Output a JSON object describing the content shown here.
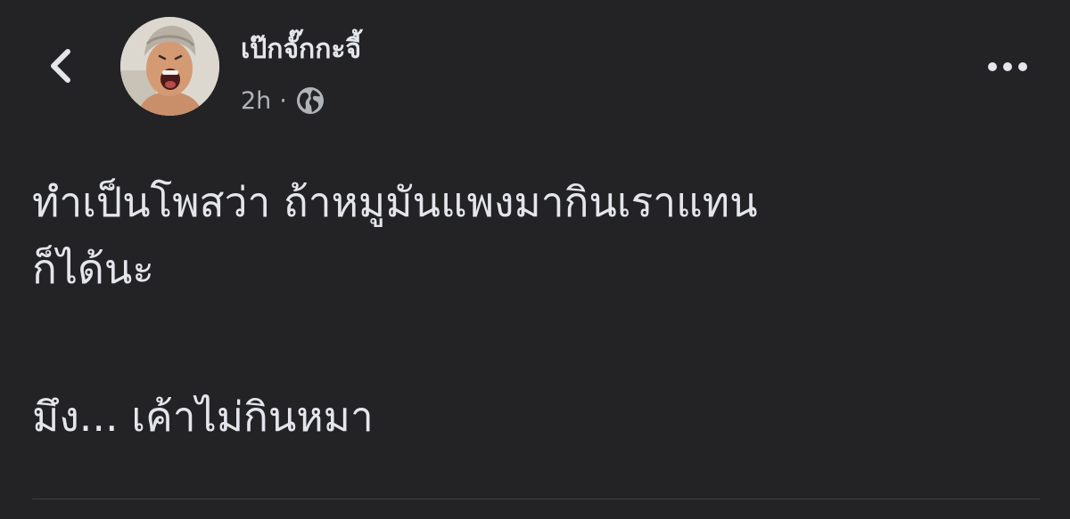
{
  "post": {
    "author_name": "เป๊กจั๊กกะจี้",
    "timestamp": "2h",
    "separator": "·",
    "audience_icon": "globe-icon",
    "text_line_1": "ทำเป็นโพสว่า ถ้าหมูมันแพงมากินเราแทน",
    "text_line_2": "ก็ได้นะ",
    "text_line_3": "มึง... เค้าไม่กินหมา"
  },
  "nav": {
    "back_icon": "chevron-left-icon",
    "more_icon": "more-horizontal-icon"
  },
  "colors": {
    "background": "#232325",
    "primary_text": "#e4e6eb",
    "secondary_text": "#b0b3b8",
    "divider": "#3e4042"
  }
}
